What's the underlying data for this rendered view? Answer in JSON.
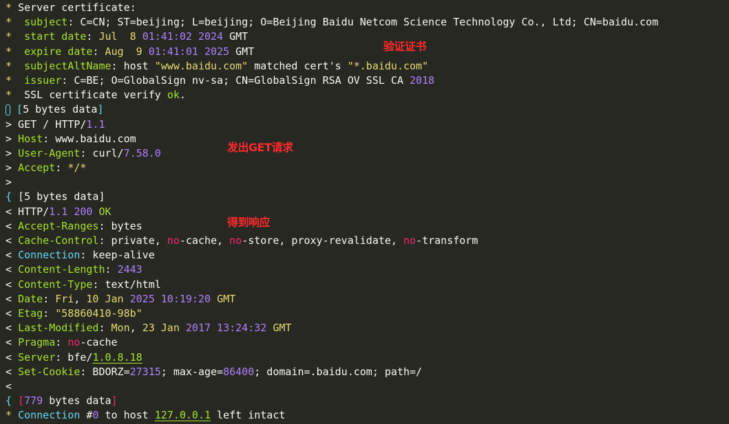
{
  "annotations": {
    "verify_cert": "验证证书",
    "send_get": "发出GET请求",
    "get_response": "得到响应"
  },
  "colors": {
    "background": "#272822",
    "foreground": "#f8f8f2",
    "key_green": "#a6e22e",
    "string_yellow": "#e6db74",
    "number_purple": "#ae81ff",
    "keyword_red": "#f92672",
    "name_blue": "#66d9ef",
    "annotation_red": "#ff2a2a"
  },
  "lines": [
    [
      [
        "t-yellow",
        "* "
      ],
      [
        "t-white",
        "Server certificate:"
      ]
    ],
    [
      [
        "t-yellow",
        "*  "
      ],
      [
        "t-green",
        "subject"
      ],
      [
        "t-white",
        ": C=CN; ST=beijing; L=beijing; O=Beijing Baidu Netcom Science Technology Co., Ltd; CN=baidu.com"
      ]
    ],
    [
      [
        "t-yellow",
        "*  "
      ],
      [
        "t-green",
        "start date"
      ],
      [
        "t-white",
        ": "
      ],
      [
        "t-yellow",
        "Jul  8 "
      ],
      [
        "t-purple",
        "01:41:02 2024"
      ],
      [
        "t-white",
        " GMT"
      ]
    ],
    [
      [
        "t-yellow",
        "*  "
      ],
      [
        "t-green",
        "expire date"
      ],
      [
        "t-white",
        ": "
      ],
      [
        "t-yellow",
        "Aug  9 "
      ],
      [
        "t-purple",
        "01:41:01 2025"
      ],
      [
        "t-white",
        " GMT"
      ]
    ],
    [
      [
        "t-yellow",
        "*  "
      ],
      [
        "t-green",
        "subjectAltName"
      ],
      [
        "t-white",
        ": host "
      ],
      [
        "t-yellow",
        "\"www.baidu.com\""
      ],
      [
        "t-white",
        " matched cert's "
      ],
      [
        "t-yellow",
        "\"*.baidu.com\""
      ]
    ],
    [
      [
        "t-yellow",
        "*  "
      ],
      [
        "t-green",
        "issuer"
      ],
      [
        "t-white",
        ": C=BE; O=GlobalSign nv-sa; CN=GlobalSign RSA OV SSL CA "
      ],
      [
        "t-purple",
        "2018"
      ]
    ],
    [
      [
        "t-yellow",
        "*  "
      ],
      [
        "t-white",
        "SSL certificate verify "
      ],
      [
        "t-green",
        "ok"
      ],
      [
        "t-white",
        "."
      ]
    ],
    [
      [
        "cursor",
        ""
      ],
      [
        "t-blue",
        " ["
      ],
      [
        "t-white",
        "5 bytes data"
      ],
      [
        "t-blue",
        "]"
      ]
    ],
    [
      [
        "t-white",
        "> GET / HTTP/"
      ],
      [
        "t-purple",
        "1.1"
      ]
    ],
    [
      [
        "t-white",
        "> "
      ],
      [
        "t-green",
        "Host"
      ],
      [
        "t-white",
        ": www.baidu.com"
      ]
    ],
    [
      [
        "t-white",
        "> "
      ],
      [
        "t-green",
        "User-Agent"
      ],
      [
        "t-white",
        ": curl/"
      ],
      [
        "t-purple",
        "7.58.0"
      ]
    ],
    [
      [
        "t-white",
        "> "
      ],
      [
        "t-green",
        "Accept"
      ],
      [
        "t-white",
        ": "
      ],
      [
        "t-yellow",
        "*/*"
      ]
    ],
    [
      [
        "t-white",
        ">"
      ]
    ],
    [
      [
        "t-blue",
        "{ "
      ],
      [
        "t-white",
        "[5 bytes data]"
      ]
    ],
    [
      [
        "t-white",
        "< HTTP/"
      ],
      [
        "t-purple",
        "1.1 200"
      ],
      [
        "t-white",
        " "
      ],
      [
        "t-green",
        "OK"
      ]
    ],
    [
      [
        "t-white",
        "< "
      ],
      [
        "t-green",
        "Accept-Ranges"
      ],
      [
        "t-white",
        ": bytes"
      ]
    ],
    [
      [
        "t-white",
        "< "
      ],
      [
        "t-green",
        "Cache-Control"
      ],
      [
        "t-white",
        ": private, "
      ],
      [
        "t-red",
        "no"
      ],
      [
        "t-white",
        "-cache, "
      ],
      [
        "t-red",
        "no"
      ],
      [
        "t-white",
        "-store, proxy-revalidate, "
      ],
      [
        "t-red",
        "no"
      ],
      [
        "t-white",
        "-transform"
      ]
    ],
    [
      [
        "t-white",
        "< "
      ],
      [
        "t-blue",
        "Connection"
      ],
      [
        "t-white",
        ": keep-alive"
      ]
    ],
    [
      [
        "t-white",
        "< "
      ],
      [
        "t-green",
        "Content-Length"
      ],
      [
        "t-white",
        ": "
      ],
      [
        "t-purple",
        "2443"
      ]
    ],
    [
      [
        "t-white",
        "< "
      ],
      [
        "t-green",
        "Content-Type"
      ],
      [
        "t-white",
        ": text/html"
      ]
    ],
    [
      [
        "t-white",
        "< "
      ],
      [
        "t-green",
        "Date"
      ],
      [
        "t-white",
        ": "
      ],
      [
        "t-yellow",
        "Fri"
      ],
      [
        "t-white",
        ", "
      ],
      [
        "t-yellow",
        "10 Jan "
      ],
      [
        "t-purple",
        "2025 10:19:20"
      ],
      [
        "t-white",
        " "
      ],
      [
        "t-yellow",
        "GMT"
      ]
    ],
    [
      [
        "t-white",
        "< "
      ],
      [
        "t-green",
        "Etag"
      ],
      [
        "t-white",
        ": "
      ],
      [
        "t-yellow",
        "\"58860410-98b\""
      ]
    ],
    [
      [
        "t-white",
        "< "
      ],
      [
        "t-green",
        "Last-Modified"
      ],
      [
        "t-white",
        ": "
      ],
      [
        "t-yellow",
        "Mon"
      ],
      [
        "t-white",
        ", "
      ],
      [
        "t-yellow",
        "23 Jan "
      ],
      [
        "t-purple",
        "2017 13:24:32"
      ],
      [
        "t-white",
        " "
      ],
      [
        "t-yellow",
        "GMT"
      ]
    ],
    [
      [
        "t-white",
        "< "
      ],
      [
        "t-green",
        "Pragma"
      ],
      [
        "t-white",
        ": "
      ],
      [
        "t-red",
        "no"
      ],
      [
        "t-white",
        "-cache"
      ]
    ],
    [
      [
        "t-white",
        "< "
      ],
      [
        "t-green",
        "Server"
      ],
      [
        "t-white",
        ": bfe/"
      ],
      [
        "t-ul",
        "1.0.8.18"
      ]
    ],
    [
      [
        "t-white",
        "< "
      ],
      [
        "t-green",
        "Set-Cookie"
      ],
      [
        "t-white",
        ": BDORZ="
      ],
      [
        "t-purple",
        "27315"
      ],
      [
        "t-white",
        "; max-age="
      ],
      [
        "t-purple",
        "86400"
      ],
      [
        "t-white",
        "; domain=.baidu.com; path=/"
      ]
    ],
    [
      [
        "t-white",
        "<"
      ]
    ],
    [
      [
        "t-blue",
        "{ "
      ],
      [
        "t-red",
        "["
      ],
      [
        "t-purple",
        "779"
      ],
      [
        "t-white",
        " bytes data"
      ],
      [
        "t-red",
        "]"
      ]
    ],
    [
      [
        "t-yellow",
        "* "
      ],
      [
        "t-blue",
        "Connection"
      ],
      [
        "t-white",
        " #"
      ],
      [
        "t-purple",
        "0"
      ],
      [
        "t-white",
        " to host "
      ],
      [
        "t-ul",
        "127.0.0.1"
      ],
      [
        "t-white",
        " left intact"
      ]
    ]
  ]
}
